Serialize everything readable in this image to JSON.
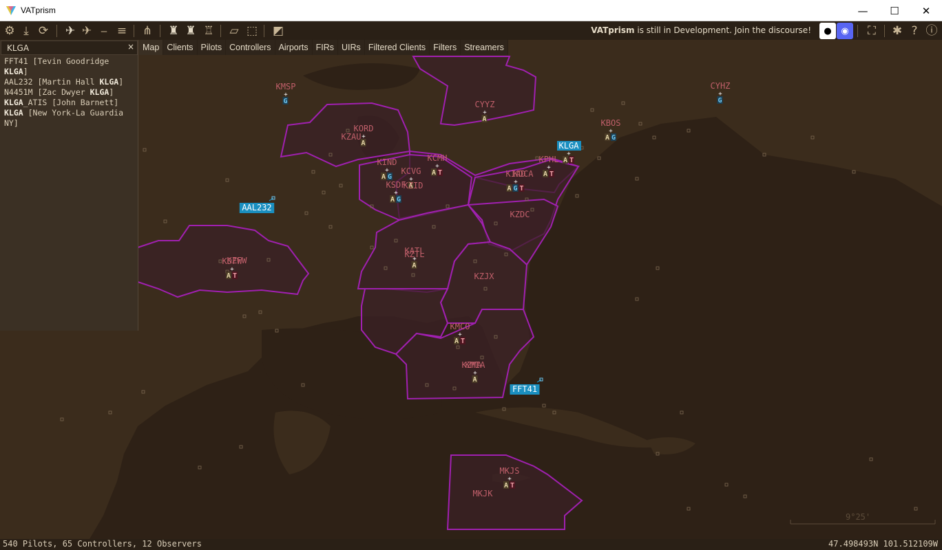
{
  "window": {
    "title": "VATprism",
    "minimize": "—",
    "maximize": "☐",
    "close": "✕"
  },
  "toolbar": {
    "dev_brand": "VATprism",
    "dev_message": "is still in Development. Join the discourse!"
  },
  "menu": {
    "items": [
      "Map",
      "Clients",
      "Pilots",
      "Controllers",
      "Airports",
      "FIRs",
      "UIRs",
      "Filtered Clients",
      "Filters",
      "Streamers"
    ]
  },
  "search": {
    "value": "KLGA",
    "close": "×",
    "results": [
      {
        "pre": "FFT41 [Tevin Goodridge ",
        "bold": "KLGA",
        "post": "]"
      },
      {
        "pre": "AAL232 [Martin Hall ",
        "bold": "KLGA",
        "post": "]"
      },
      {
        "pre": "N4451M [Zac Dwyer ",
        "bold": "KLGA",
        "post": "]"
      },
      {
        "pre": "",
        "bold": "KLGA",
        "post": "_ATIS [John Barnett]"
      },
      {
        "pre": "",
        "bold": "KLGA",
        "post": " [New York-La Guardia NY]"
      }
    ]
  },
  "map": {
    "colors": {
      "land": "#3b2c1c",
      "sea": "#2e2116",
      "fir_fill": "#3b2026",
      "fir_border": "#a020b0",
      "label": "#c05f6a",
      "highlight": "#1a8fc0"
    },
    "airports": [
      {
        "name": "KMSP",
        "badges": "G"
      },
      {
        "name": "CYYZ",
        "badges": "A"
      },
      {
        "name": "CYHZ",
        "badges": "G"
      },
      {
        "name": "KBOS",
        "badges": "AG"
      },
      {
        "name": "KORD",
        "badges": "A"
      },
      {
        "name": "KZAU",
        "badges": ""
      },
      {
        "name": "KIND",
        "badges": "AG"
      },
      {
        "name": "KCMH",
        "badges": "AT"
      },
      {
        "name": "KCVG",
        "badges": "A"
      },
      {
        "name": "KSDF",
        "badges": "AG"
      },
      {
        "name": "KZID",
        "badges": ""
      },
      {
        "name": "KIAD",
        "badges": "AGT"
      },
      {
        "name": "KDCA",
        "badges": ""
      },
      {
        "name": "KPHL",
        "badges": "AT"
      },
      {
        "name": "KLGA",
        "badges": "AT"
      },
      {
        "name": "KZDC",
        "badges": ""
      },
      {
        "name": "KATL",
        "badges": "A"
      },
      {
        "name": "KZTL",
        "badges": ""
      },
      {
        "name": "KZJX",
        "badges": ""
      },
      {
        "name": "KDFW",
        "badges": "AT"
      },
      {
        "name": "KZFW",
        "badges": ""
      },
      {
        "name": "KMCO",
        "badges": "AT"
      },
      {
        "name": "KMIA",
        "badges": "A"
      },
      {
        "name": "KZMA",
        "badges": ""
      },
      {
        "name": "MKJS",
        "badges": "AT"
      },
      {
        "name": "MKJK",
        "badges": ""
      }
    ],
    "aircraft": [
      {
        "callsign": "AAL232"
      },
      {
        "callsign": "FFT41"
      }
    ],
    "scale_label": "9°25'"
  },
  "status": {
    "counts": "540 Pilots, 65 Controllers, 12 Observers",
    "coords": "47.498493N 101.512109W"
  }
}
